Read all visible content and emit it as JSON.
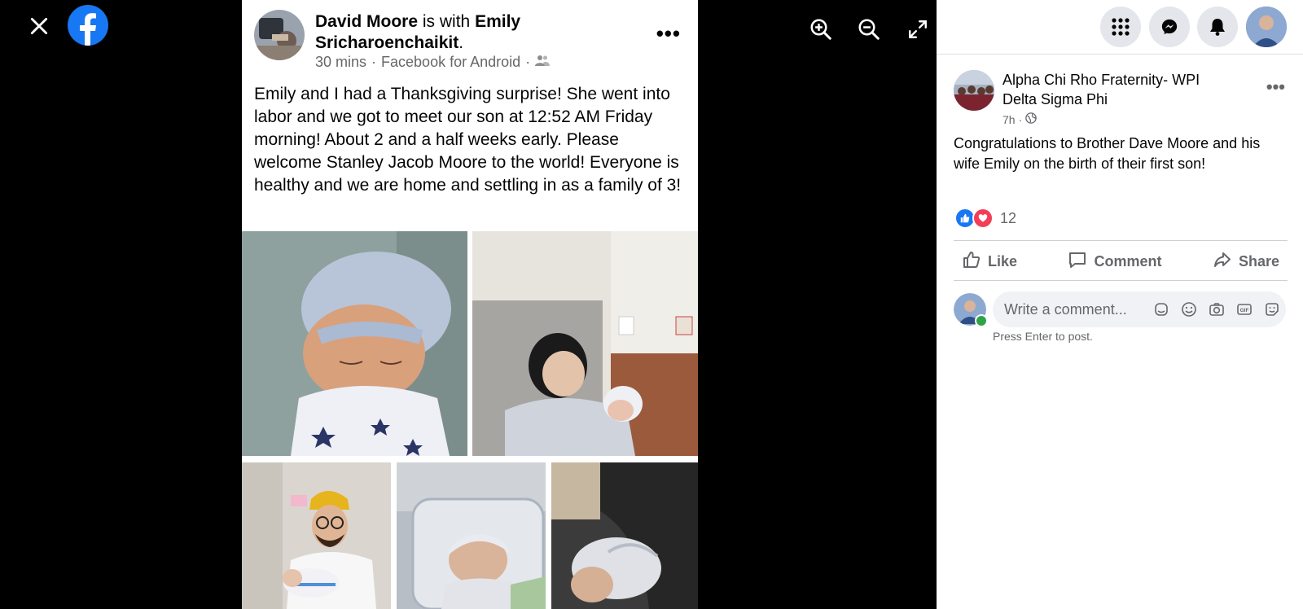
{
  "viewer": {
    "close_icon": "close-icon",
    "logo_icon": "facebook-logo-icon",
    "tools": [
      "zoom-in-icon",
      "zoom-out-icon",
      "fullscreen-icon"
    ]
  },
  "photo_post": {
    "author": "David Moore",
    "is_with": "is with",
    "tagged": "Emily Sricharoenchaikit",
    "period": ".",
    "meta_time": "30 mins",
    "meta_source": "Facebook for Android",
    "meta_sep": "·",
    "audience_icon": "friends-icon",
    "more": "•••",
    "text": "Emily and I had a Thanksgiving surprise! She went into labor and we got to meet our son at 12:52 AM Friday morning! About 2 and a half weeks early. Please welcome Stanley Jacob Moore to the world! Everyone is healthy and we are home and settling in as a family of 3!"
  },
  "post": {
    "author_line1": "Alpha Chi Rho Fraternity- WPI",
    "author_line2": "Delta Sigma Phi",
    "time": "7h",
    "time_sep": "·",
    "privacy_icon": "globe-icon",
    "more": "•••",
    "text": "Congratulations to Brother Dave Moore and his wife Emily on the birth of their first son!",
    "reaction_count": "12",
    "reactions": [
      "like-icon",
      "love-icon"
    ],
    "actions": {
      "like": "Like",
      "comment": "Comment",
      "share": "Share"
    },
    "comment_placeholder": "Write a comment...",
    "comment_tools": [
      "avatar-sticker-icon",
      "emoji-icon",
      "camera-icon",
      "gif-icon",
      "sticker-icon"
    ],
    "press_enter": "Press Enter to post."
  },
  "topbar": {
    "icons": [
      "menu-grid-icon",
      "messenger-icon",
      "notifications-icon",
      "profile-avatar"
    ]
  },
  "colors": {
    "brand": "#1877f2",
    "viewer_bg": "#000000",
    "secondary_text": "#65676b",
    "button_bg": "#e4e6eb",
    "online": "#31a24c",
    "love": "#f33e58"
  }
}
